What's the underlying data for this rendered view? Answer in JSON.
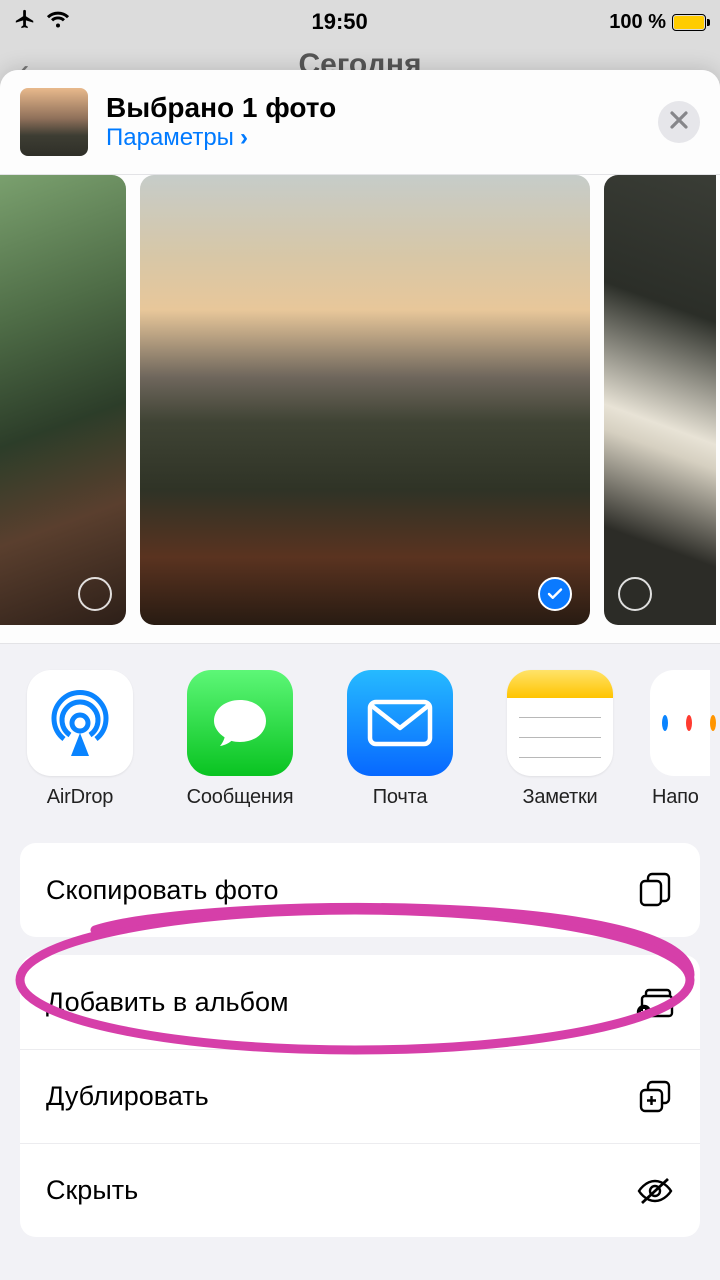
{
  "status": {
    "time": "19:50",
    "battery": "100 %"
  },
  "nav": {
    "title": "Сегодня"
  },
  "sheet_header": {
    "title": "Выбрано 1 фото",
    "options_link": "Параметры"
  },
  "apps": [
    {
      "label": "AirDrop"
    },
    {
      "label": "Сообщения"
    },
    {
      "label": "Почта"
    },
    {
      "label": "Заметки"
    },
    {
      "label": "Напо"
    }
  ],
  "actions": {
    "copy": "Скопировать фото",
    "add_album": "Добавить в альбом",
    "duplicate": "Дублировать",
    "hide": "Скрыть"
  }
}
